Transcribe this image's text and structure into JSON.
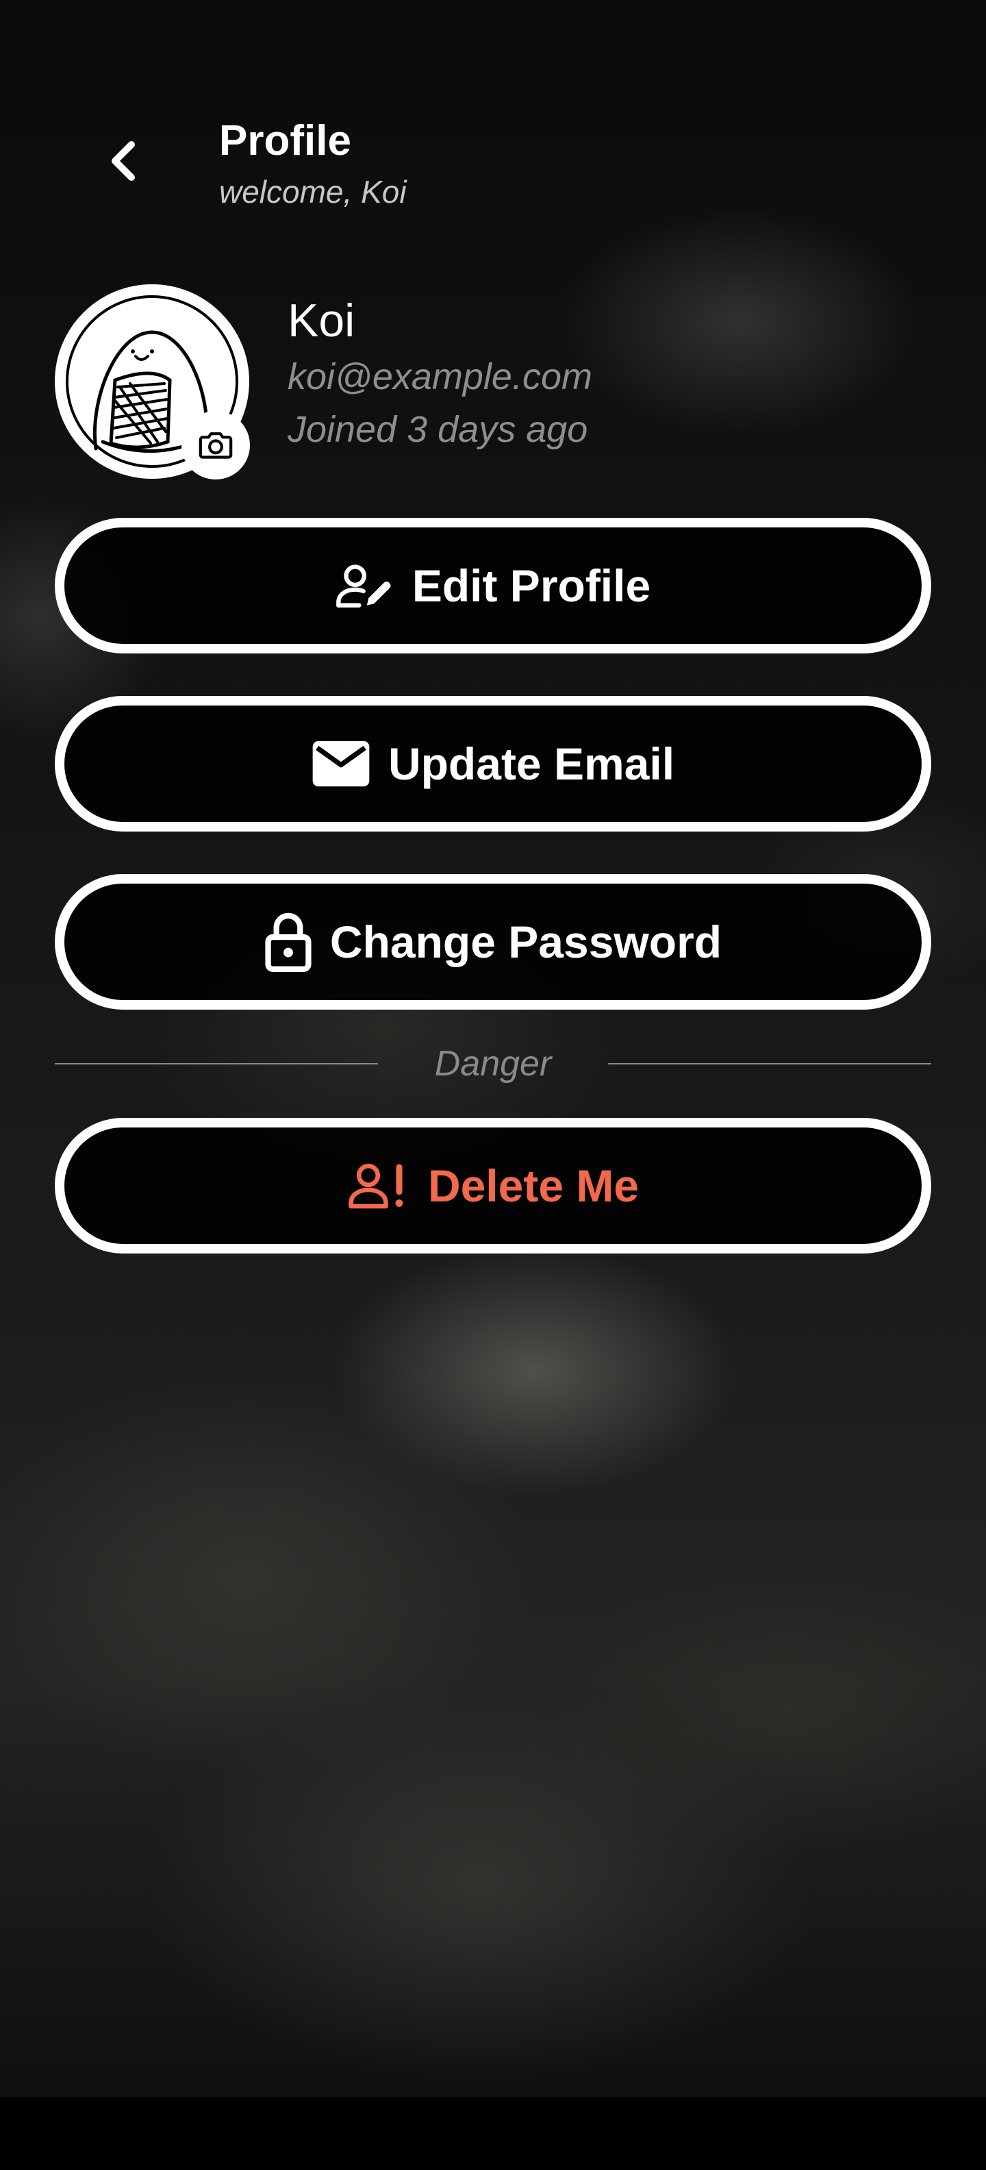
{
  "header": {
    "title": "Profile",
    "subtitle": "welcome, Koi"
  },
  "profile": {
    "name": "Koi",
    "email": "koi@example.com",
    "joined": "Joined 3 days ago"
  },
  "actions": {
    "edit_profile": "Edit Profile",
    "update_email": "Update Email",
    "change_password": "Change Password"
  },
  "danger": {
    "section_label": "Danger",
    "delete_label": "Delete Me"
  },
  "colors": {
    "background": "#000000",
    "text": "#ffffff",
    "muted": "#8e8e8e",
    "danger": "#f26a4b"
  },
  "icons": {
    "back": "chevron-left-icon",
    "camera": "camera-icon",
    "edit_profile": "user-edit-icon",
    "update_email": "mail-icon",
    "change_password": "lock-icon",
    "delete": "user-alert-icon"
  }
}
